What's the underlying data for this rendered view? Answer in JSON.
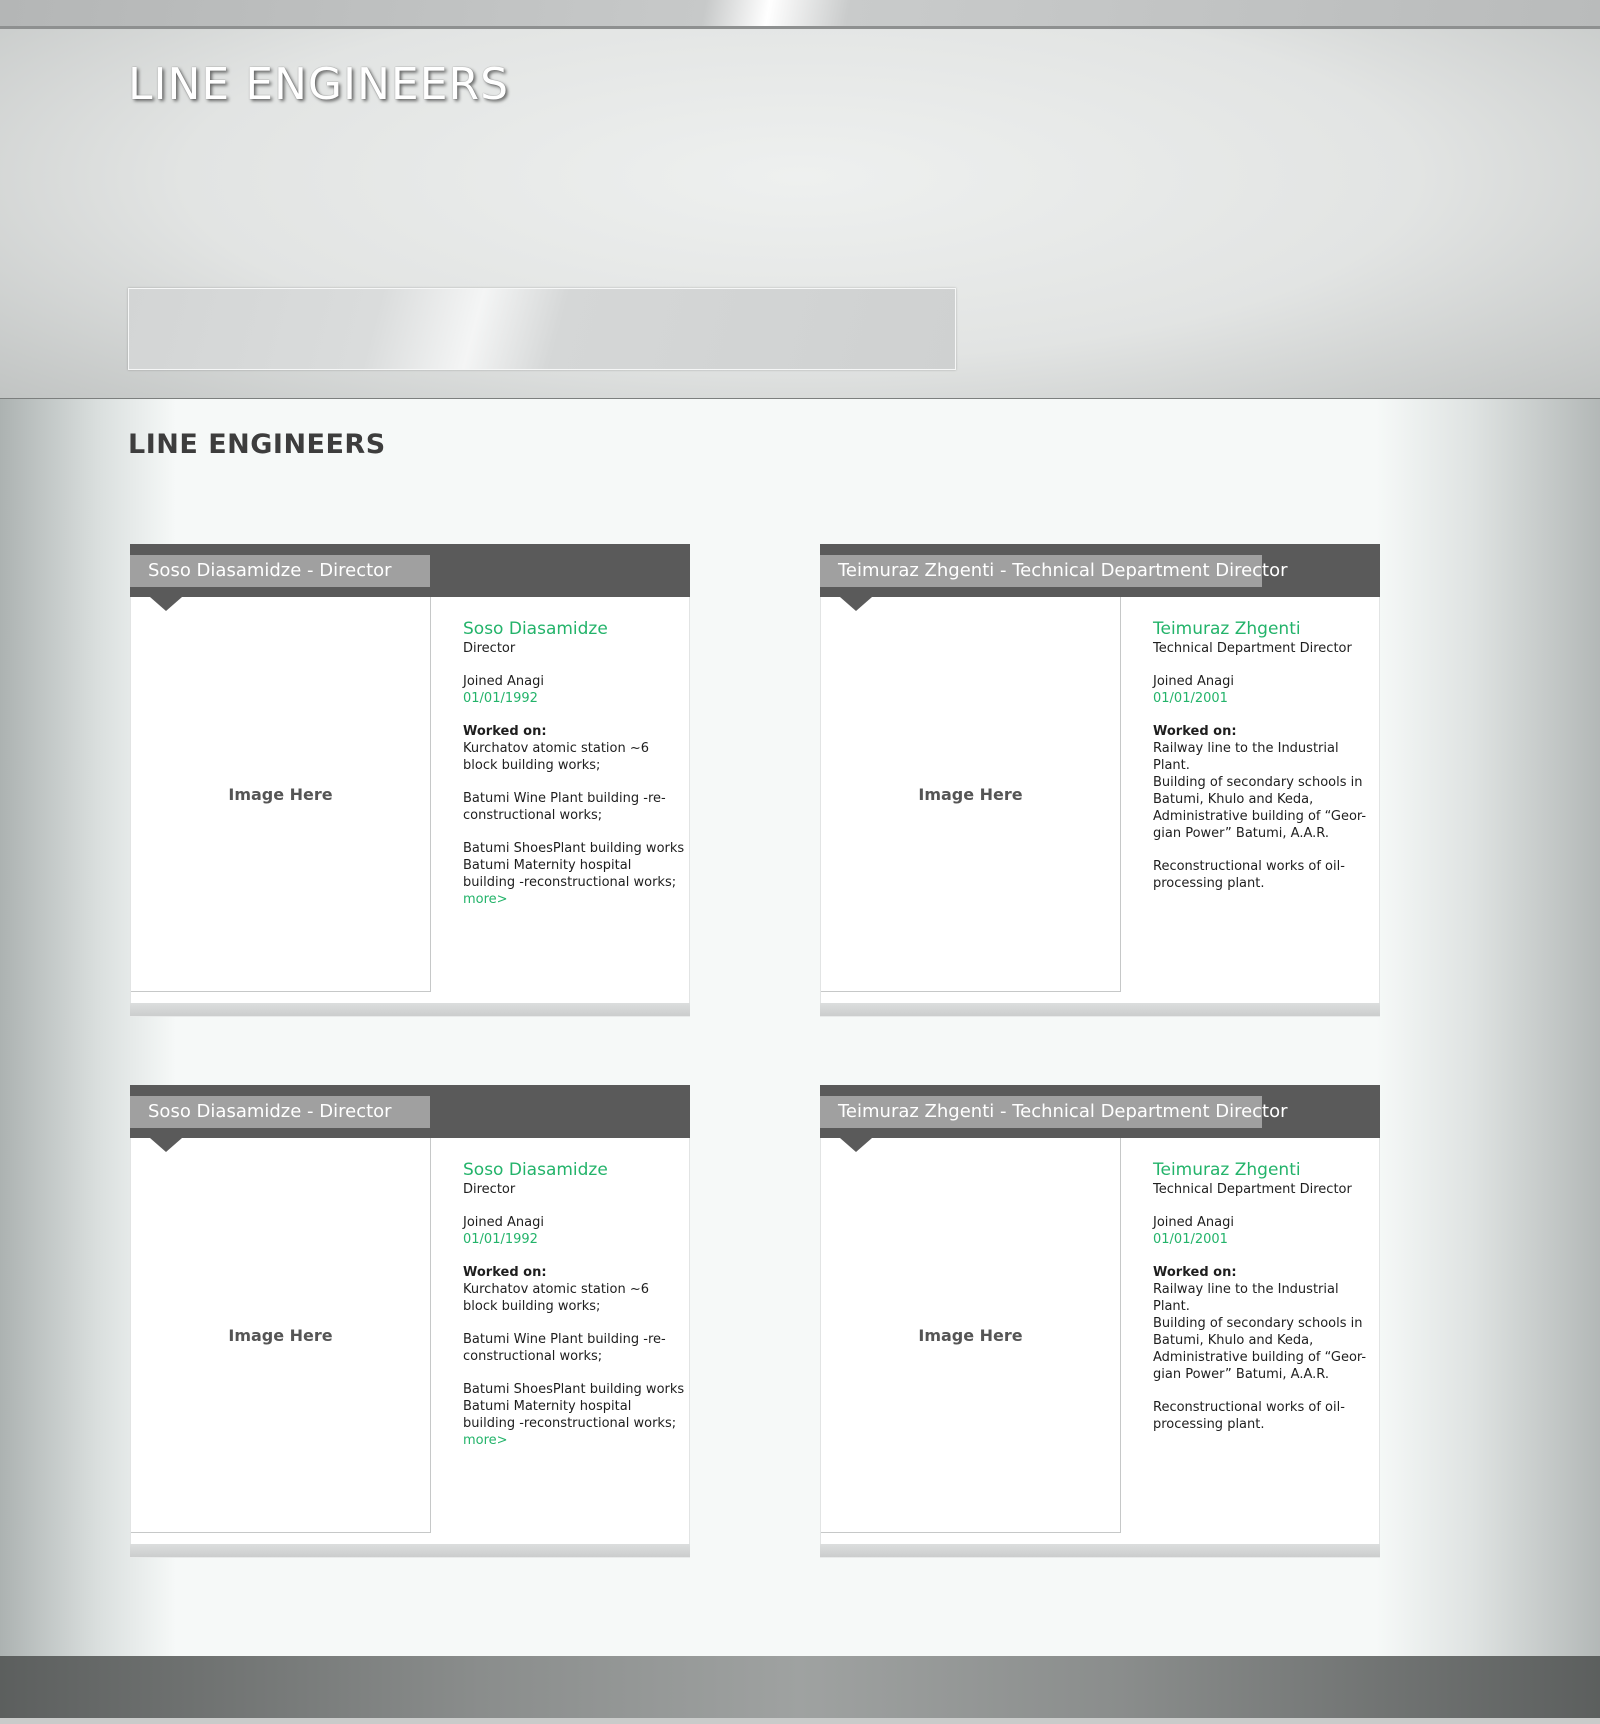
{
  "header": {
    "logo_text": "LINE ENGINEERS"
  },
  "main": {
    "title": "LINE ENGINEERS"
  },
  "cards": [
    {
      "tab": "Soso Diasamidze - Director",
      "image_placeholder": "Image Here",
      "name": "Soso Diasamidze",
      "role": "Director",
      "joined_label": "Joined Anagi",
      "joined_date": "01/01/1992",
      "worked_label": "Worked on:",
      "p1": "Kurchatov atomic station ~6 block building works;",
      "p2": "Batumi Wine Plant building -re-constructional works;",
      "p3a": "Batumi ShoesPlant building works",
      "p3b": "Batumi Maternity hospital building -reconstructional works; ",
      "more": "more>"
    },
    {
      "tab": "Teimuraz Zhgenti - Technical Department Director",
      "image_placeholder": "Image Here",
      "name": "Teimuraz Zhgenti",
      "role": "Technical Department Director",
      "joined_label": "Joined Anagi",
      "joined_date": "01/01/2001",
      "worked_label": "Worked on:",
      "p1a": "Railway line to the Industrial Plant.",
      "p1b": "Building of secondary schools in Batumi, Khulo and Keda,",
      "p1c": "Administrative building of “Geor-gian Power” Batumi, A.A.R.",
      "p2": "Reconstructional works of oil-processing plant."
    },
    {
      "tab": "Soso Diasamidze - Director",
      "image_placeholder": "Image Here",
      "name": "Soso Diasamidze",
      "role": "Director",
      "joined_label": "Joined Anagi",
      "joined_date": "01/01/1992",
      "worked_label": "Worked on:",
      "p1": "Kurchatov atomic station ~6 block building works;",
      "p2": "Batumi Wine Plant building -re-constructional works;",
      "p3a": "Batumi ShoesPlant building works",
      "p3b": "Batumi Maternity hospital building -reconstructional works; ",
      "more": "more>"
    },
    {
      "tab": "Teimuraz Zhgenti - Technical Department Director",
      "image_placeholder": "Image Here",
      "name": "Teimuraz Zhgenti",
      "role": "Technical Department Director",
      "joined_label": "Joined Anagi",
      "joined_date": "01/01/2001",
      "worked_label": "Worked on:",
      "p1a": "Railway line to the Industrial Plant.",
      "p1b": "Building of secondary schools in Batumi, Khulo and Keda,",
      "p1c": "Administrative building of “Geor-gian Power” Batumi, A.A.R.",
      "p2": "Reconstructional works of oil-processing plant."
    }
  ],
  "colors": {
    "accent_green": "#23b36a",
    "card_bar": "#5a5a5a",
    "card_tab": "#a0a0a0"
  }
}
